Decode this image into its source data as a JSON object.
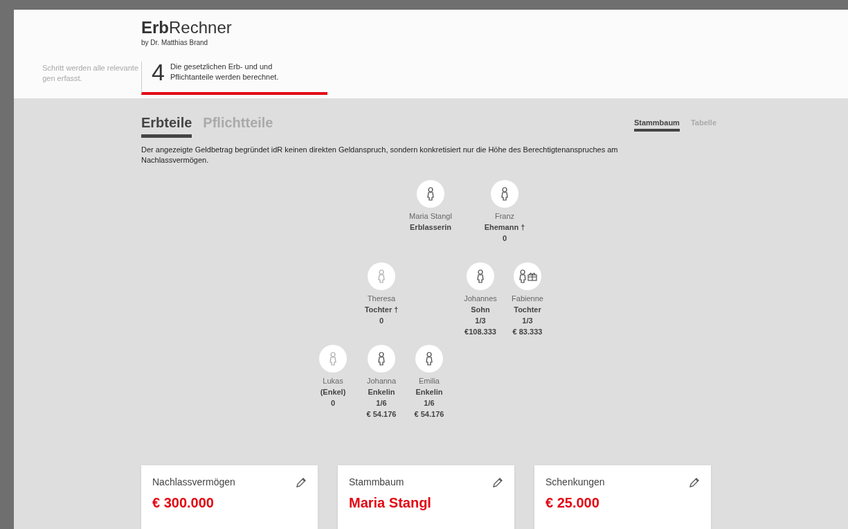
{
  "brand": {
    "bold": "Erb",
    "regular": "Rechner",
    "byline": "by Dr. Matthias Brand"
  },
  "steps": [
    {
      "text": "Schritt werden alle relevante\ngen erfasst.",
      "selected": false
    },
    {
      "number": "4",
      "text": "Die gesetzlichen Erb- und und\nPflichtanteile werden berechnet.",
      "selected": true
    }
  ],
  "tabs": [
    {
      "label": "Erbteile",
      "selected": true
    },
    {
      "label": "Pflichtteile",
      "selected": false
    }
  ],
  "view_tabs": [
    {
      "label": "Stammbaum",
      "selected": true
    },
    {
      "label": "Tabelle",
      "selected": false
    }
  ],
  "notice": "Der angezeigte Geldbetrag begründet idR keinen direkten Geldanspruch, sondern konkretisiert nur die Höhe des Berechtigtenanspruches am Nachlassvermögen.",
  "tree": [
    {
      "name": "Maria Stangl",
      "role": "Erblasserin",
      "dimmed": false,
      "gift": false
    },
    {
      "name": "Franz",
      "role": "Ehemann †",
      "share": "0",
      "dimmed": false,
      "gift": false
    },
    {
      "name": "Theresa",
      "role": "Tochter †",
      "share": "0",
      "dimmed": true,
      "gift": false
    },
    {
      "name": "Johannes",
      "role": "Sohn",
      "share": "1/3",
      "amount": "€108.333",
      "dimmed": false,
      "gift": false
    },
    {
      "name": "Fabienne",
      "role": "Tochter",
      "share": "1/3",
      "amount": "€ 83.333",
      "dimmed": false,
      "gift": true
    },
    {
      "name": "Lukas",
      "role": "(Enkel)",
      "share": "0",
      "dimmed": true,
      "gift": false
    },
    {
      "name": "Johanna",
      "role": "Enkelin",
      "share": "1/6",
      "amount": "€ 54.176",
      "dimmed": false,
      "gift": false
    },
    {
      "name": "Emilia",
      "role": "Enkelin",
      "share": "1/6",
      "amount": "€ 54.176",
      "dimmed": false,
      "gift": false
    }
  ],
  "cards": [
    {
      "title": "Nachlassvermögen",
      "value": "€ 300.000"
    },
    {
      "title": "Stammbaum",
      "value": "Maria Stangl"
    },
    {
      "title": "Schenkungen",
      "value": "€ 25.000"
    }
  ]
}
